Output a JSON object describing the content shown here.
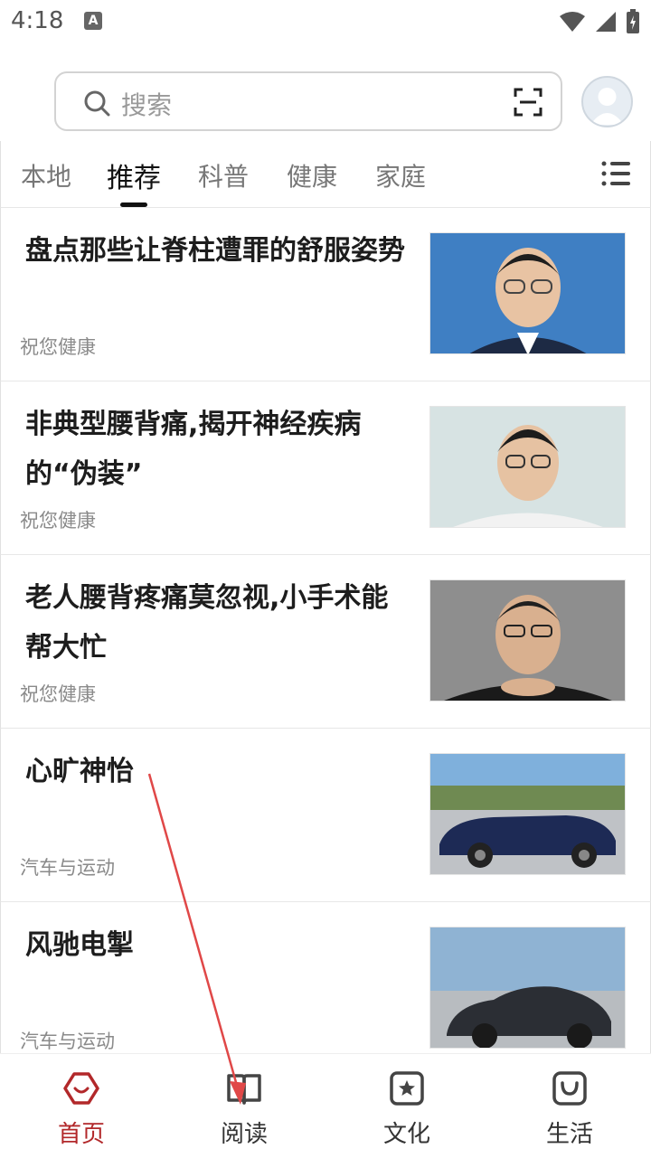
{
  "status_bar": {
    "time": "4:18",
    "notification_letter": "A"
  },
  "search": {
    "placeholder": "搜索"
  },
  "tabs": [
    {
      "label": "本地",
      "active": false
    },
    {
      "label": "推荐",
      "active": true
    },
    {
      "label": "科普",
      "active": false
    },
    {
      "label": "健康",
      "active": false
    },
    {
      "label": "家庭",
      "active": false
    }
  ],
  "feed": [
    {
      "title": "盘点那些让脊柱遭罪的舒服姿势",
      "source": "祝您健康",
      "thumb": "portrait-man-blue-background"
    },
    {
      "title": "非典型腰背痛,揭开神经疾病的“伪装”",
      "source": "祝您健康",
      "thumb": "portrait-man-glasses-light-background"
    },
    {
      "title": "老人腰背疼痛莫忽视,小手术能帮大忙",
      "source": "祝您健康",
      "thumb": "portrait-older-man-glasses"
    },
    {
      "title": "心旷神怡",
      "source": "汽车与运动",
      "thumb": "blue-convertible-car"
    },
    {
      "title": "风驰电掣",
      "source": "汽车与运动",
      "thumb": "dark-sedan-car"
    }
  ],
  "bottom_nav": [
    {
      "label": "首页",
      "icon": "home-hexagon-icon",
      "active": true
    },
    {
      "label": "阅读",
      "icon": "book-icon",
      "active": false
    },
    {
      "label": "文化",
      "icon": "star-square-icon",
      "active": false
    },
    {
      "label": "生活",
      "icon": "smile-bag-icon",
      "active": false
    }
  ],
  "colors": {
    "accent": "#b2282a",
    "annotation_arrow": "#e04848"
  }
}
